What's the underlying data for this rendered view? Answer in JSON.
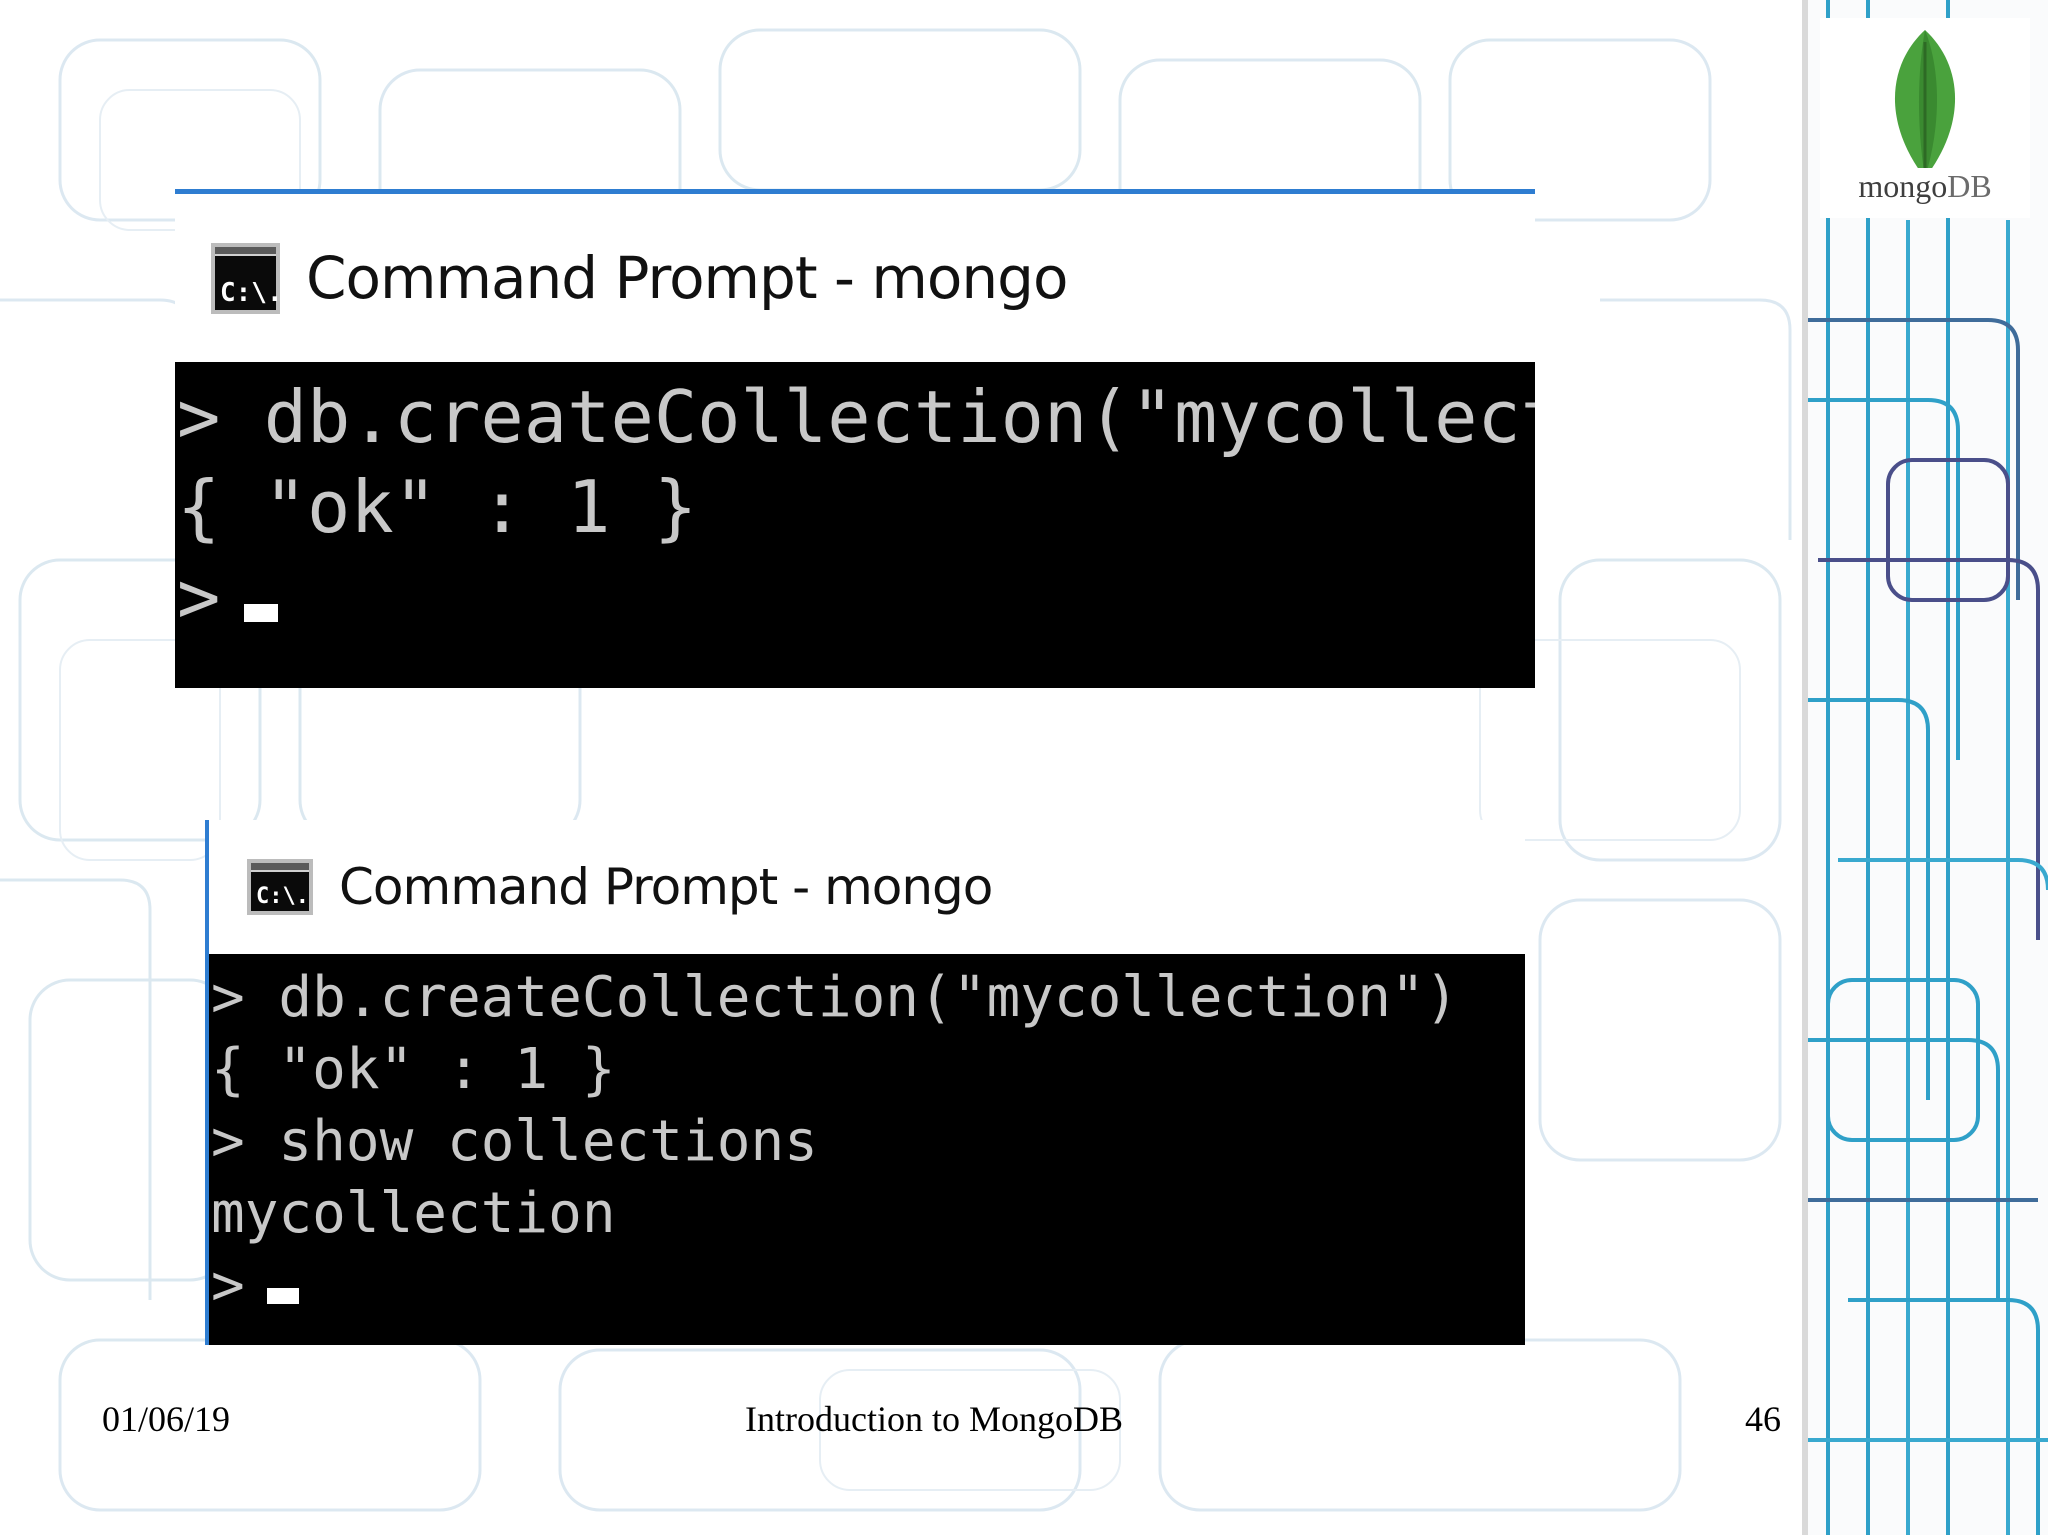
{
  "logo": {
    "word_mongo": "mongo",
    "word_db": "DB",
    "leaf_icon": "mongodb-leaf-icon"
  },
  "window1": {
    "icon": "command-prompt-icon",
    "icon_text": "C:\\.",
    "title": "Command Prompt - mongo",
    "lines": [
      "> db.createCollection(\"mycollection\")",
      "{ \"ok\" : 1 }",
      ">"
    ]
  },
  "window2": {
    "icon": "command-prompt-icon",
    "icon_text": "C:\\.",
    "title": "Command Prompt - mongo",
    "lines": [
      "> db.createCollection(\"mycollection\")",
      "{ \"ok\" : 1 }",
      "> show collections",
      "mycollection",
      ">"
    ]
  },
  "footer": {
    "date": "01/06/19",
    "title": "Introduction to MongoDB",
    "page": "46"
  },
  "colors": {
    "accent_rule": "#2e7dd1",
    "console_bg": "#000000",
    "console_text": "#c8c8c8",
    "leaf_green": "#4aa23d"
  }
}
